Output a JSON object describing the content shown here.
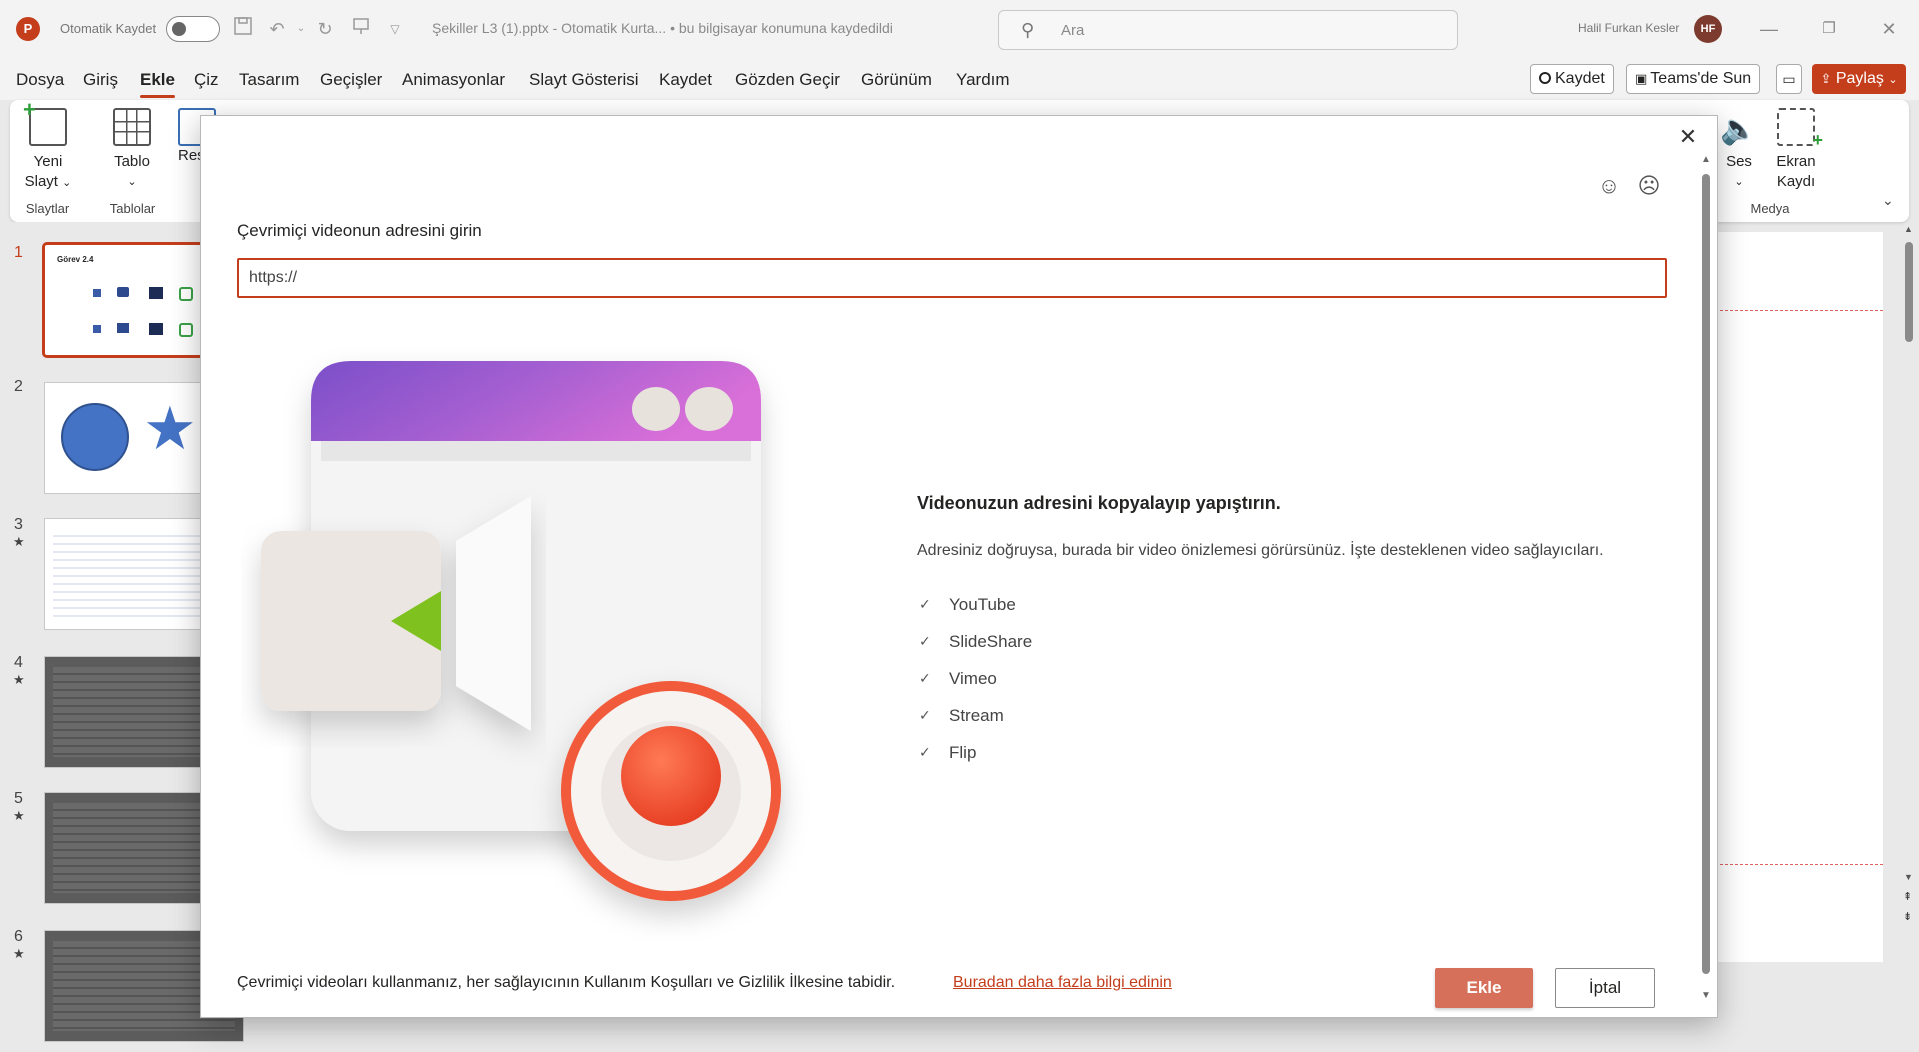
{
  "titlebar": {
    "autosave_label": "Otomatik Kaydet",
    "doc_title": "Şekiller L3 (1).pptx  -  Otomatik Kurta...  •  bu bilgisayar konumuna kaydedildi",
    "search_placeholder": "Ara",
    "user_name": "Halil Furkan Kesler",
    "user_initials": "HF"
  },
  "menu": {
    "tabs": [
      "Dosya",
      "Giriş",
      "Ekle",
      "Çiz",
      "Tasarım",
      "Geçişler",
      "Animasyonlar",
      "Slayt Gösterisi",
      "Kaydet",
      "Gözden Geçir",
      "Görünüm",
      "Yardım"
    ],
    "active_tab": "Ekle",
    "record_label": "Kaydet",
    "teams_label": "Teams'de Sun",
    "share_label": "Paylaş"
  },
  "ribbon": {
    "new_slide_1": "Yeni",
    "new_slide_2": "Slayt",
    "table_label": "Tablo",
    "picture_label": "Resi",
    "group_slides": "Slaytlar",
    "group_tables": "Tablolar",
    "audio_label": "Ses",
    "screen_rec_1": "Ekran",
    "screen_rec_2": "Kaydı",
    "group_media": "Medya"
  },
  "thumbs": {
    "numbers": [
      "1",
      "2",
      "3",
      "4",
      "5",
      "6"
    ],
    "slide1_title": "Görev 2.4"
  },
  "dialog": {
    "url_label": "Çevrimiçi videonun adresini girin",
    "url_value": "https://",
    "info_title": "Videonuzun adresini kopyalayıp yapıştırın.",
    "info_desc": "Adresiniz doğruysa, burada bir video önizlemesi görürsünüz. İşte desteklenen video sağlayıcıları.",
    "providers": [
      "YouTube",
      "SlideShare",
      "Vimeo",
      "Stream",
      "Flip"
    ],
    "footer_note": "Çevrimiçi videoları kullanmanız, her sağlayıcının Kullanım Koşulları ve Gizlilik İlkesine tabidir.",
    "learn_more": "Buradan daha fazla bilgi edinin",
    "insert_label": "Ekle",
    "cancel_label": "İptal"
  },
  "colors": {
    "accent": "#c43e1c",
    "primary_button": "#d6705a"
  }
}
